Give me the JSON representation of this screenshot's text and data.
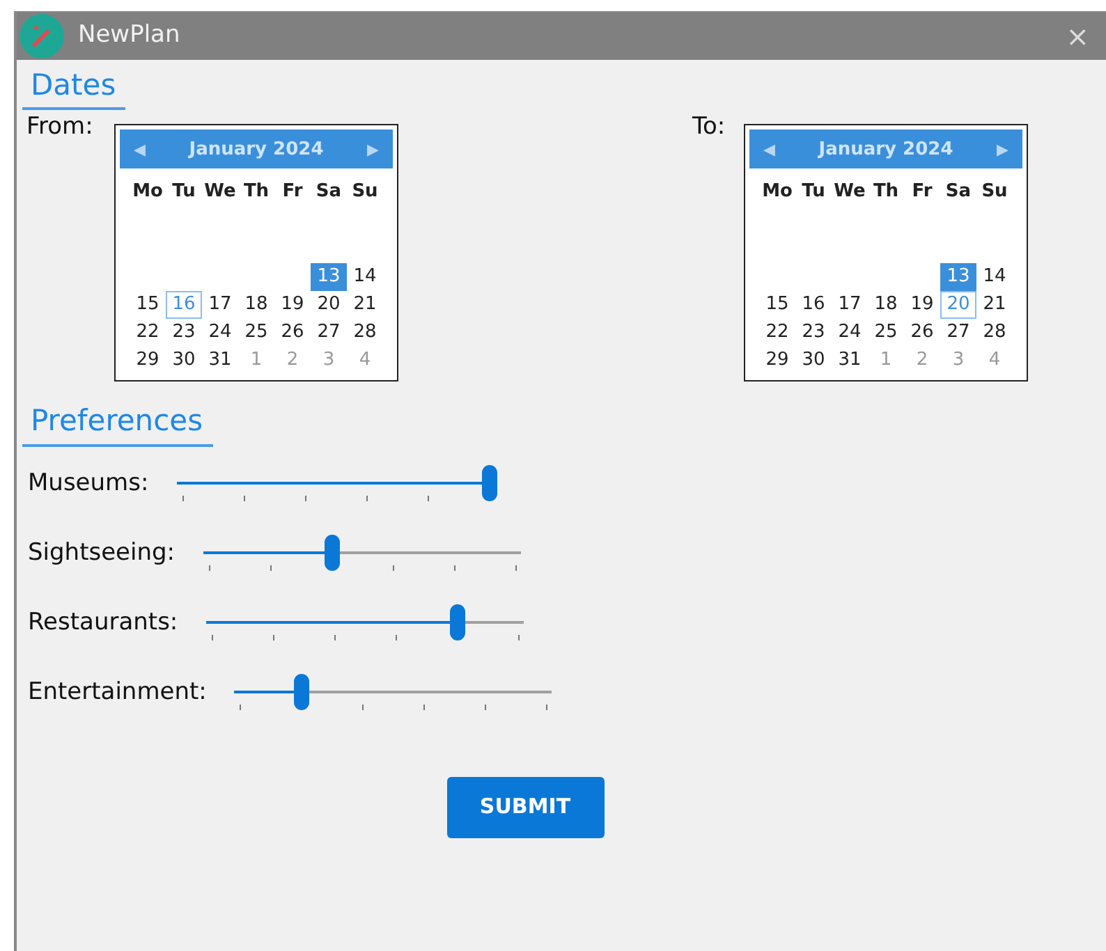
{
  "window": {
    "title": "NewPlan",
    "close": "×"
  },
  "dates": {
    "heading": "Dates",
    "calendars": [
      {
        "label": "From:",
        "month": "January 2024",
        "prev": "◀",
        "next": "▶",
        "weekdays": [
          "Mo",
          "Tu",
          "We",
          "Th",
          "Fr",
          "Sa",
          "Su"
        ],
        "weeks": [
          [
            {
              "kind": "blank"
            },
            {
              "kind": "blank"
            },
            {
              "kind": "blank"
            },
            {
              "kind": "blank"
            },
            {
              "kind": "blank"
            },
            {
              "kind": "blank"
            },
            {
              "kind": "blank"
            }
          ],
          [
            {
              "kind": "blank"
            },
            {
              "kind": "blank"
            },
            {
              "kind": "blank"
            },
            {
              "kind": "blank"
            },
            {
              "kind": "blank"
            },
            {
              "kind": "blank"
            },
            {
              "kind": "blank"
            }
          ],
          [
            {
              "kind": "blank"
            },
            {
              "kind": "blank"
            },
            {
              "kind": "blank"
            },
            {
              "kind": "blank"
            },
            {
              "kind": "blank"
            },
            {
              "kind": "day",
              "text": "13",
              "selected": true,
              "focused": false
            },
            {
              "kind": "day",
              "text": "14",
              "selected": false,
              "focused": false
            }
          ],
          [
            {
              "kind": "day",
              "text": "15",
              "selected": false,
              "focused": false
            },
            {
              "kind": "day",
              "text": "16",
              "selected": false,
              "focused": true
            },
            {
              "kind": "day",
              "text": "17",
              "selected": false,
              "focused": false
            },
            {
              "kind": "day",
              "text": "18",
              "selected": false,
              "focused": false
            },
            {
              "kind": "day",
              "text": "19",
              "selected": false,
              "focused": false
            },
            {
              "kind": "day",
              "text": "20",
              "selected": false,
              "focused": false
            },
            {
              "kind": "day",
              "text": "21",
              "selected": false,
              "focused": false
            }
          ],
          [
            {
              "kind": "day",
              "text": "22",
              "selected": false,
              "focused": false
            },
            {
              "kind": "day",
              "text": "23",
              "selected": false,
              "focused": false
            },
            {
              "kind": "day",
              "text": "24",
              "selected": false,
              "focused": false
            },
            {
              "kind": "day",
              "text": "25",
              "selected": false,
              "focused": false
            },
            {
              "kind": "day",
              "text": "26",
              "selected": false,
              "focused": false
            },
            {
              "kind": "day",
              "text": "27",
              "selected": false,
              "focused": false
            },
            {
              "kind": "day",
              "text": "28",
              "selected": false,
              "focused": false
            }
          ],
          [
            {
              "kind": "day",
              "text": "29",
              "selected": false,
              "focused": false
            },
            {
              "kind": "day",
              "text": "30",
              "selected": false,
              "focused": false
            },
            {
              "kind": "day",
              "text": "31",
              "selected": false,
              "focused": false
            },
            {
              "kind": "other",
              "text": "1",
              "selected": false,
              "focused": false
            },
            {
              "kind": "other",
              "text": "2",
              "selected": false,
              "focused": false
            },
            {
              "kind": "other",
              "text": "3",
              "selected": false,
              "focused": false
            },
            {
              "kind": "other",
              "text": "4",
              "selected": false,
              "focused": false
            }
          ]
        ]
      },
      {
        "label": "To:",
        "month": "January 2024",
        "prev": "◀",
        "next": "▶",
        "weekdays": [
          "Mo",
          "Tu",
          "We",
          "Th",
          "Fr",
          "Sa",
          "Su"
        ],
        "weeks": [
          [
            {
              "kind": "blank"
            },
            {
              "kind": "blank"
            },
            {
              "kind": "blank"
            },
            {
              "kind": "blank"
            },
            {
              "kind": "blank"
            },
            {
              "kind": "blank"
            },
            {
              "kind": "blank"
            }
          ],
          [
            {
              "kind": "blank"
            },
            {
              "kind": "blank"
            },
            {
              "kind": "blank"
            },
            {
              "kind": "blank"
            },
            {
              "kind": "blank"
            },
            {
              "kind": "blank"
            },
            {
              "kind": "blank"
            }
          ],
          [
            {
              "kind": "blank"
            },
            {
              "kind": "blank"
            },
            {
              "kind": "blank"
            },
            {
              "kind": "blank"
            },
            {
              "kind": "blank"
            },
            {
              "kind": "day",
              "text": "13",
              "selected": true,
              "focused": false
            },
            {
              "kind": "day",
              "text": "14",
              "selected": false,
              "focused": false
            }
          ],
          [
            {
              "kind": "day",
              "text": "15",
              "selected": false,
              "focused": false
            },
            {
              "kind": "day",
              "text": "16",
              "selected": false,
              "focused": false
            },
            {
              "kind": "day",
              "text": "17",
              "selected": false,
              "focused": false
            },
            {
              "kind": "day",
              "text": "18",
              "selected": false,
              "focused": false
            },
            {
              "kind": "day",
              "text": "19",
              "selected": false,
              "focused": false
            },
            {
              "kind": "day",
              "text": "20",
              "selected": false,
              "focused": true
            },
            {
              "kind": "day",
              "text": "21",
              "selected": false,
              "focused": false
            }
          ],
          [
            {
              "kind": "day",
              "text": "22",
              "selected": false,
              "focused": false
            },
            {
              "kind": "day",
              "text": "23",
              "selected": false,
              "focused": false
            },
            {
              "kind": "day",
              "text": "24",
              "selected": false,
              "focused": false
            },
            {
              "kind": "day",
              "text": "25",
              "selected": false,
              "focused": false
            },
            {
              "kind": "day",
              "text": "26",
              "selected": false,
              "focused": false
            },
            {
              "kind": "day",
              "text": "27",
              "selected": false,
              "focused": false
            },
            {
              "kind": "day",
              "text": "28",
              "selected": false,
              "focused": false
            }
          ],
          [
            {
              "kind": "day",
              "text": "29",
              "selected": false,
              "focused": false
            },
            {
              "kind": "day",
              "text": "30",
              "selected": false,
              "focused": false
            },
            {
              "kind": "day",
              "text": "31",
              "selected": false,
              "focused": false
            },
            {
              "kind": "other",
              "text": "1",
              "selected": false,
              "focused": false
            },
            {
              "kind": "other",
              "text": "2",
              "selected": false,
              "focused": false
            },
            {
              "kind": "other",
              "text": "3",
              "selected": false,
              "focused": false
            },
            {
              "kind": "other",
              "text": "4",
              "selected": false,
              "focused": false
            }
          ]
        ]
      }
    ]
  },
  "preferences": {
    "heading": "Preferences",
    "sliders": [
      {
        "label": "Museums:",
        "level": 1.0
      },
      {
        "label": "Sightseeing:",
        "level": 0.4
      },
      {
        "label": "Restaurants:",
        "level": 0.8
      },
      {
        "label": "Entertainment:",
        "level": 0.2
      }
    ]
  },
  "submit": "SUBMIT"
}
